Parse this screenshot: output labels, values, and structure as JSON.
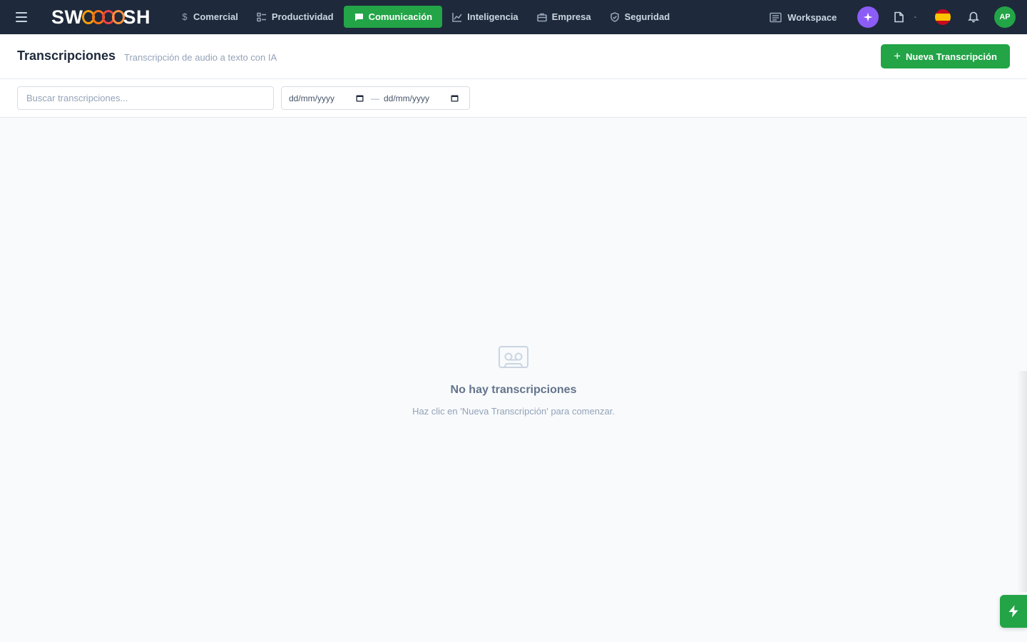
{
  "app": {
    "brand": {
      "prefix": "SW",
      "suffix": "SH"
    },
    "nav": [
      {
        "id": "comercial",
        "label": "Comercial",
        "icon": "dollar-icon",
        "active": false
      },
      {
        "id": "productividad",
        "label": "Productividad",
        "icon": "checklist-icon",
        "active": false
      },
      {
        "id": "comunicacion",
        "label": "Comunicación",
        "icon": "chat-icon",
        "active": true
      },
      {
        "id": "inteligencia",
        "label": "Inteligencia",
        "icon": "line-chart-icon",
        "active": false
      },
      {
        "id": "empresa",
        "label": "Empresa",
        "icon": "briefcase-icon",
        "active": false
      },
      {
        "id": "seguridad",
        "label": "Seguridad",
        "icon": "shield-icon",
        "active": false
      }
    ],
    "workspace_label": "Workspace",
    "mini_dash": "-",
    "avatar_initials": "AP"
  },
  "page": {
    "title": "Transcripciones",
    "subtitle": "Transcripción de audio a texto con IA",
    "new_button": "Nueva Transcripción"
  },
  "filters": {
    "search_placeholder": "Buscar transcripciones...",
    "date_from": "dd/mm/yyyy",
    "date_separator": "—",
    "date_to": "dd/mm/yyyy"
  },
  "empty_state": {
    "title": "No hay transcripciones",
    "message": "Haz clic en 'Nueva Transcripción' para comenzar."
  },
  "colors": {
    "topbar": "#1e293b",
    "accent": "#22a447",
    "ai": "#8b5cf6"
  }
}
